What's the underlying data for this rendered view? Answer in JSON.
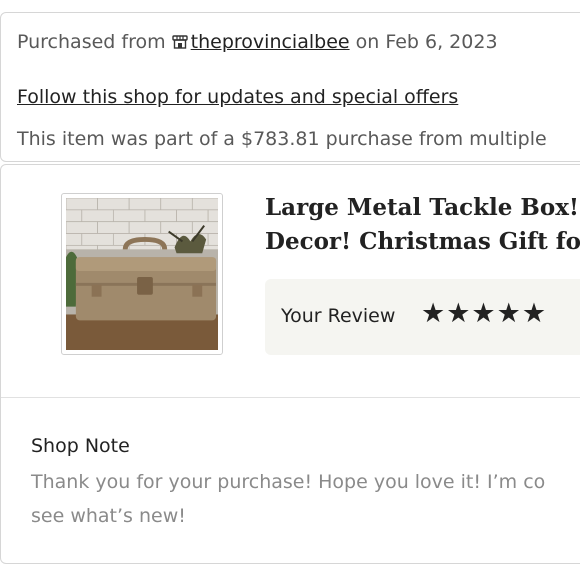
{
  "purchase": {
    "prefix": "Purchased from",
    "shop_name": "theprovincialbee",
    "date_text": "on Feb 6, 2023",
    "follow_text": "Follow this shop for updates and special offers",
    "item_part_text": "This item was part of a $783.81 purchase from multiple"
  },
  "item": {
    "title_line1": "Large Metal Tackle Box! R",
    "title_line2": "Decor! Christmas Gift for D",
    "review_label": "Your Review",
    "rating": 5,
    "rating_max": 5,
    "stars_text": "★★★★★"
  },
  "shop_note": {
    "label": "Shop Note",
    "line1": "Thank you for your purchase! Hope you love it! I’m co",
    "line2": "see what’s new!"
  },
  "icons": {
    "shop": "shop-icon",
    "star": "star-icon"
  },
  "colors": {
    "text_primary": "#222222",
    "text_secondary": "#595959",
    "text_muted": "#8a8a8a",
    "review_bg": "#f5f5f1",
    "border": "#d6d6d6"
  }
}
